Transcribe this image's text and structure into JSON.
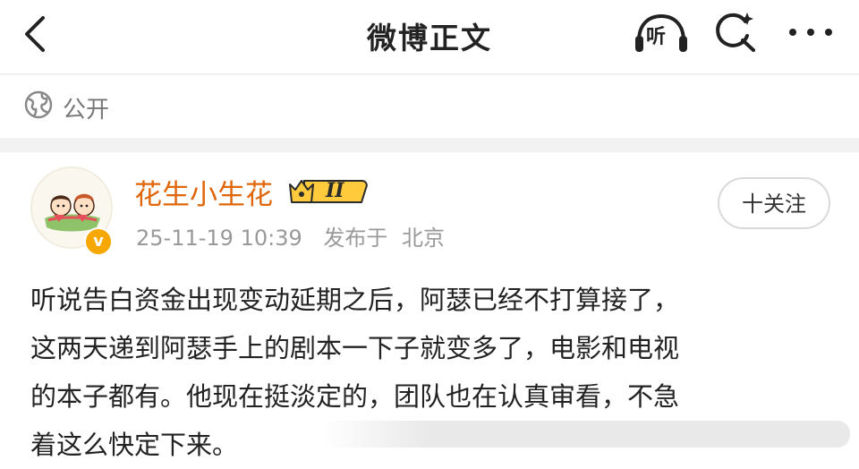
{
  "header": {
    "title": "微博正文",
    "listen_label": "听"
  },
  "visibility": {
    "label": "公开"
  },
  "author": {
    "name": "花生小生花",
    "rank_text": "II",
    "verified_mark": "v",
    "time": "25-11-19 10:39",
    "location_prefix": "发布于",
    "location": "北京"
  },
  "follow": {
    "label": "十关注"
  },
  "post": {
    "lines": [
      "听说告白资金出现变动延期之后，阿瑟已经不打算接了，",
      "这两天递到阿瑟手上的剧本一下子就变多了，电影和电视",
      "的本子都有。他现在挺淡定的，团队也在认真审看，不急",
      "着这么快定下来。"
    ]
  },
  "colors": {
    "accent_name": "#e0660a",
    "badge_gold": "#f7a800",
    "meta_gray": "#999999"
  },
  "icons": [
    "back-chevron-icon",
    "headphones-icon",
    "search-icon",
    "more-icon",
    "globe-icon",
    "crown-icon"
  ]
}
